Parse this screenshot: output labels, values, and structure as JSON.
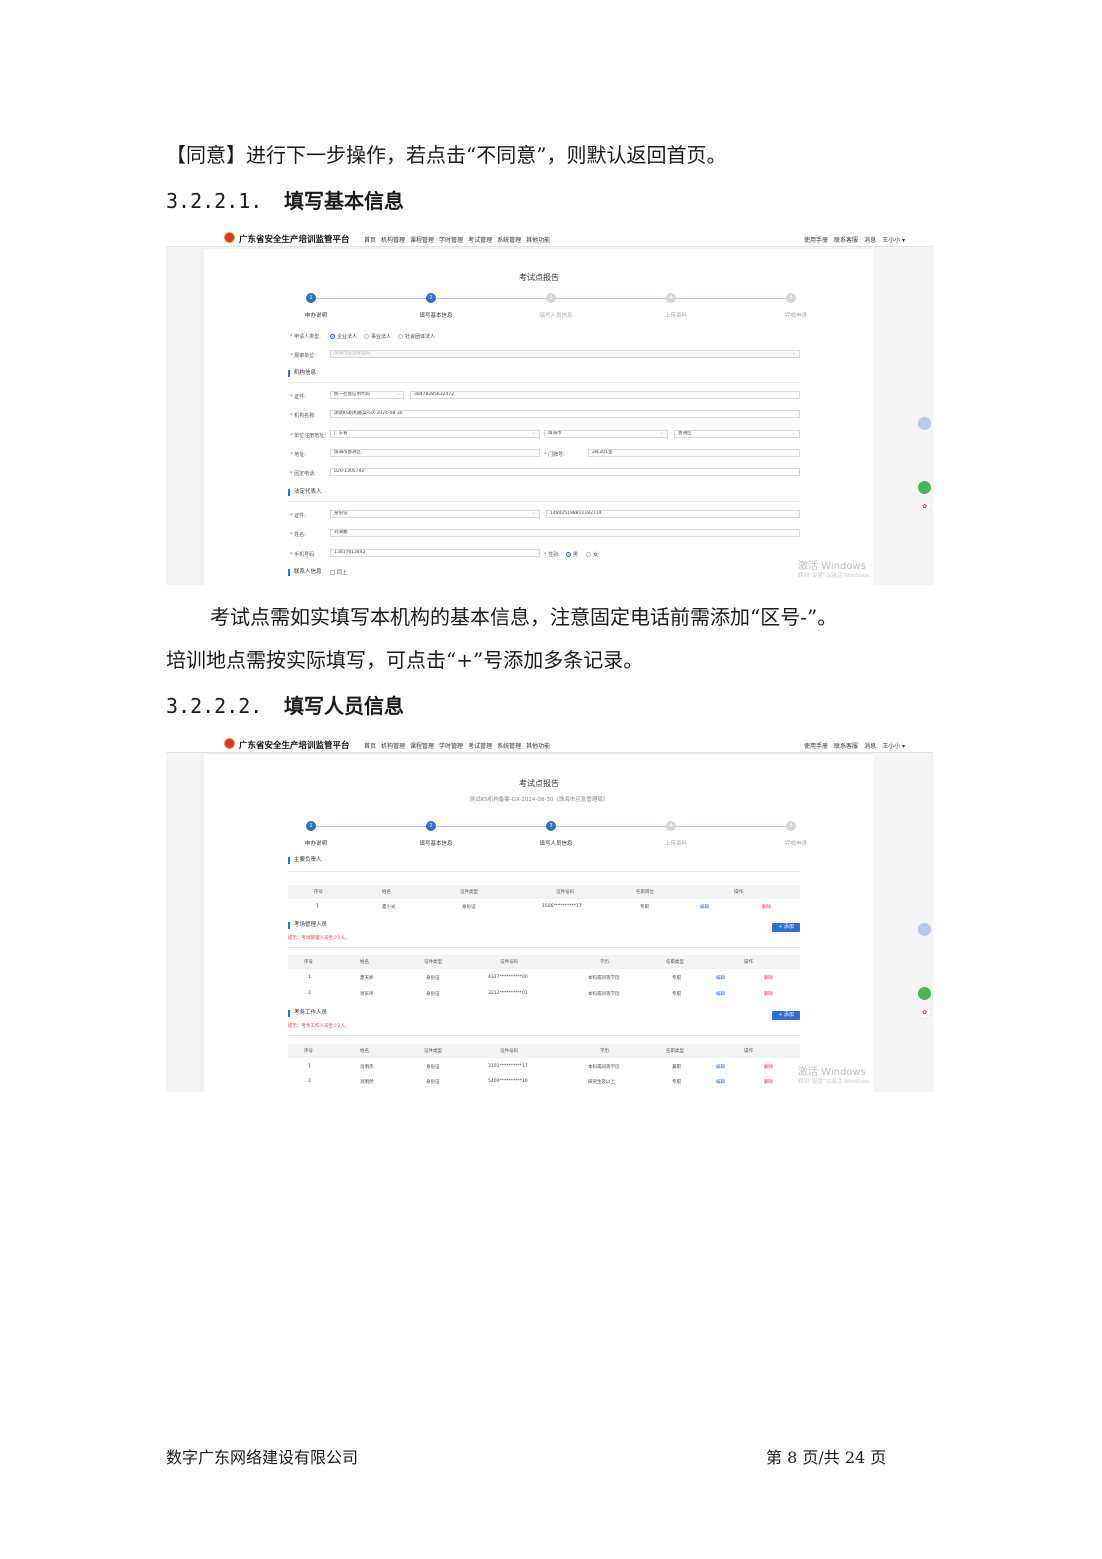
{
  "intro_text": "【同意】进行下一步操作，若点击“不同意”，则默认返回首页。",
  "section1": {
    "number": "3.2.2.1.",
    "title": "填写基本信息"
  },
  "section2": {
    "number": "3.2.2.2.",
    "title": "填写人员信息"
  },
  "desc1": "考试点需如实填写本机构的基本信息，注意固定电话前需添加“区号-”。",
  "desc2": "培训地点需按实际填写，可点击“+”号添加多条记录。",
  "footer": {
    "company": "数字广东网络建设有限公司",
    "page": "第 8 页/共 24 页"
  },
  "app": {
    "brand": "广东省安全生产培训监管平台",
    "nav": [
      "首页",
      "机构管理",
      "课程管理",
      "学时管理",
      "考试管理",
      "系统管理",
      "其他功能"
    ],
    "top_right": [
      "使用手册",
      "联系客服",
      "消息",
      "王小小 ▾"
    ],
    "page_title": "考试点报告",
    "page_sub": "测试KS机构备案-GX-2024-08-30（珠海市应急管理局）",
    "steps": [
      "申办说明",
      "填写基本信息",
      "填写人员信息",
      "上传资料",
      "完成申请"
    ],
    "watermark": "激活 Windows",
    "watermark_sub": "转到“设置”以激活 Windows。"
  },
  "form": {
    "applicant_type_label": "申请人类型:",
    "applicant_types": [
      "企业法人",
      "事业法人",
      "社会团体法人"
    ],
    "report_unit_label": "报审单位:",
    "report_unit_placeholder": "珠海市应急管理局",
    "org_info": "机构信息",
    "cert_label": "证件:",
    "cert_type": "统一社会信用代码",
    "cert_no": "38478285632472",
    "org_name_label": "机构名称:",
    "org_name": "测试KS机构备案-GX-2024-08-30",
    "region_label": "单位注册地址:",
    "province": "广东省",
    "city": "珠海市",
    "district": "香洲区",
    "address_label": "地址:",
    "address": "珠海市香洲区",
    "door_label": "门牌号:",
    "door": "2栋201室",
    "phone_label": "固定电话:",
    "phone": "020-1305792",
    "legal_info": "法定代表人",
    "legal_cert_label": "证件:",
    "legal_cert_type": "身份证",
    "legal_cert_no": "148425198811182714",
    "legal_name_label": "姓名:",
    "legal_name": "刘海鹏",
    "mobile_label": "手机号码:",
    "mobile": "13817613442",
    "gender_label": "性别:",
    "gender_options": [
      "男",
      "女"
    ],
    "contact_info": "联系人信息",
    "same_label": "同上"
  },
  "people": {
    "leader_section": "主要负责人",
    "leader_headers": [
      "序号",
      "姓名",
      "证件类型",
      "证件号码",
      "任职岗位",
      "操作"
    ],
    "leader_rows": [
      [
        "1",
        "夏小光",
        "身份证",
        "1506**********17",
        "专职",
        "编辑",
        "删除"
      ]
    ],
    "manager_section": "考场管理人员",
    "manager_hint": "提示：考场管理人员至少1人。",
    "add_label": "+ 添加",
    "manager_headers": [
      "序号",
      "姓名",
      "证件类型",
      "证件号码",
      "学历",
      "任职类型",
      "操作"
    ],
    "manager_rows": [
      [
        "1",
        "夏天娇",
        "身份证",
        "4327**********00",
        "本科或同等学历",
        "专职",
        "编辑",
        "删除"
      ],
      [
        "2",
        "肖东坪",
        "身份证",
        "3212**********01",
        "本科或同等学历",
        "专职",
        "编辑",
        "删除"
      ]
    ],
    "staff_section": "考务工作人员",
    "staff_hint": "提示：考务工作人员至少2人。",
    "staff_headers": [
      "序号",
      "姓名",
      "证件类型",
      "证件号码",
      "学历",
      "任职类型",
      "操作"
    ],
    "staff_rows": [
      [
        "1",
        "肖明杰",
        "身份证",
        "3101**********17",
        "本科或同等学历",
        "兼职",
        "编辑",
        "删除"
      ],
      [
        "2",
        "肖明然",
        "身份证",
        "5400**********10",
        "研究生及以上",
        "专职",
        "编辑",
        "删除"
      ]
    ]
  }
}
